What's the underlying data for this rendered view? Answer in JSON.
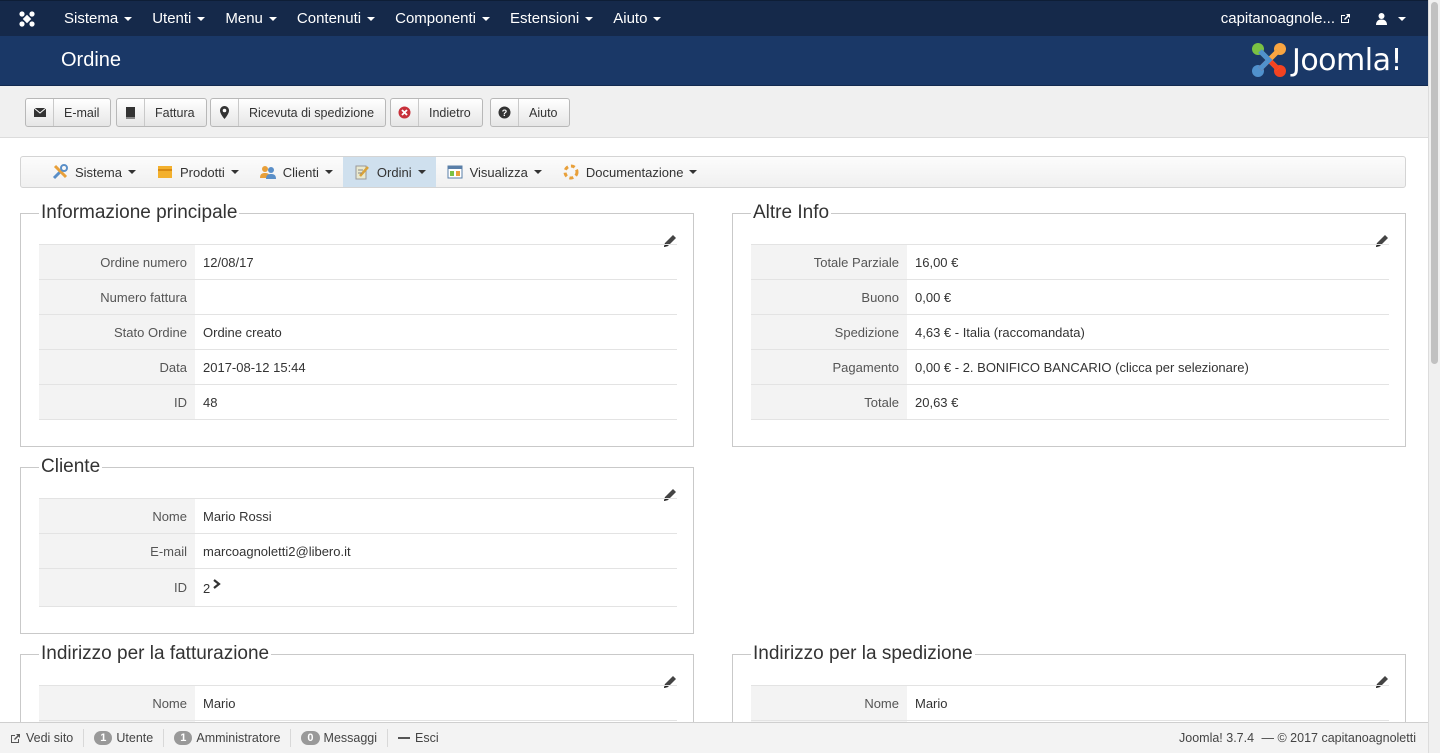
{
  "topnav": {
    "menu": [
      "Sistema",
      "Utenti",
      "Menu",
      "Contenuti",
      "Componenti",
      "Estensioni",
      "Aiuto"
    ],
    "site_name": "capitanoagnole..."
  },
  "header": {
    "title": "Ordine",
    "logo_text": "Joomla!"
  },
  "toolbar": {
    "email": "E-mail",
    "invoice": "Fattura",
    "shipping_receipt": "Ricevuta di spedizione",
    "back": "Indietro",
    "help": "Aiuto"
  },
  "subnav": {
    "items": [
      "Sistema",
      "Prodotti",
      "Clienti",
      "Ordini",
      "Visualizza",
      "Documentazione"
    ],
    "active": "Ordini"
  },
  "main_info": {
    "title": "Informazione principale",
    "rows": [
      {
        "label": "Ordine numero",
        "value": "12/08/17"
      },
      {
        "label": "Numero fattura",
        "value": ""
      },
      {
        "label": "Stato Ordine",
        "value": "Ordine creato"
      },
      {
        "label": "Data",
        "value": "2017-08-12 15:44"
      },
      {
        "label": "ID",
        "value": "48"
      }
    ]
  },
  "other_info": {
    "title": "Altre Info",
    "rows": [
      {
        "label": "Totale Parziale",
        "value": "16,00 €"
      },
      {
        "label": "Buono",
        "value": "0,00 €"
      },
      {
        "label": "Spedizione",
        "value": "4,63 € - Italia (raccomandata)"
      },
      {
        "label": "Pagamento",
        "value": "0,00 € - 2. BONIFICO BANCARIO (clicca per selezionare)"
      },
      {
        "label": "Totale",
        "value": "20,63 €"
      }
    ]
  },
  "customer": {
    "title": "Cliente",
    "rows": [
      {
        "label": "Nome",
        "value": "Mario Rossi"
      },
      {
        "label": "E-mail",
        "value": "marcoagnoletti2@libero.it"
      },
      {
        "label": "ID",
        "value": "2"
      }
    ]
  },
  "billing": {
    "title": "Indirizzo per la fatturazione",
    "rows": [
      {
        "label": "Nome",
        "value": "Mario"
      }
    ]
  },
  "shipping": {
    "title": "Indirizzo per la spedizione",
    "rows": [
      {
        "label": "Nome",
        "value": "Mario"
      }
    ]
  },
  "statusbar": {
    "view_site": "Vedi sito",
    "users_count": "1",
    "users_label": "Utente",
    "admins_count": "1",
    "admins_label": "Amministratore",
    "messages_count": "0",
    "messages_label": "Messaggi",
    "logout": "Esci",
    "version": "Joomla! 3.7.4",
    "copyright": "— © 2017 capitanoagnoletti"
  },
  "colors": {
    "navbar": "#15294a",
    "header": "#1a3867",
    "active_tab": "#cfe0ee"
  },
  "icons": [
    "joomla-icon",
    "external-link-icon",
    "user-icon",
    "envelope-icon",
    "book-icon",
    "map-pin-icon",
    "cancel-circle-icon",
    "question-icon",
    "pencil-icon",
    "chevron-right-icon"
  ]
}
